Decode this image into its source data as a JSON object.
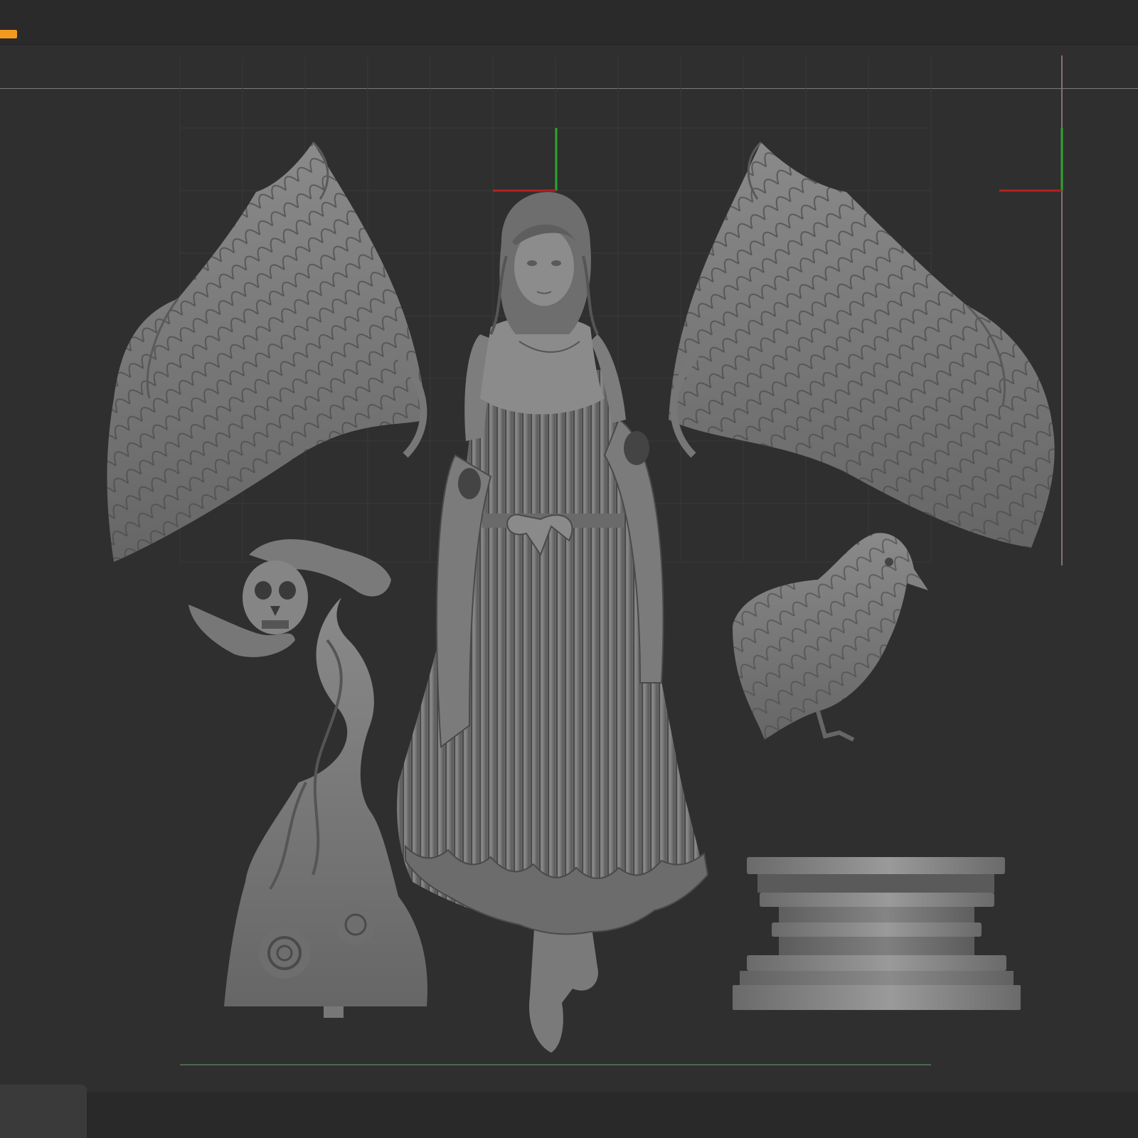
{
  "app": {
    "accent_color": "#f39a1e",
    "background_color": "#303030",
    "model_color": "#7d7d7d"
  },
  "viewport": {
    "axis_colors": {
      "x": "#b32121",
      "y": "#2fa52f"
    },
    "grid": true
  },
  "scene_objects": [
    {
      "name": "angel-figure"
    },
    {
      "name": "left-wing"
    },
    {
      "name": "right-wing"
    },
    {
      "name": "skull-hands"
    },
    {
      "name": "flame-roses-base"
    },
    {
      "name": "crow"
    },
    {
      "name": "round-pedestal"
    }
  ]
}
